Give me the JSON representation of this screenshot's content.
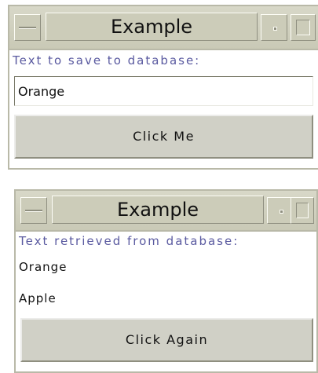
{
  "window1": {
    "title": "Example",
    "label": "Text to save to database:",
    "input_value": "Orange",
    "button_label": "Click Me"
  },
  "window2": {
    "title": "Example",
    "label": "Text retrieved from database:",
    "items": [
      "Orange",
      "Apple"
    ],
    "button_label": "Click Again"
  },
  "icons": [
    "minimize-icon",
    "menu-dot-icon",
    "maximize-icon"
  ]
}
